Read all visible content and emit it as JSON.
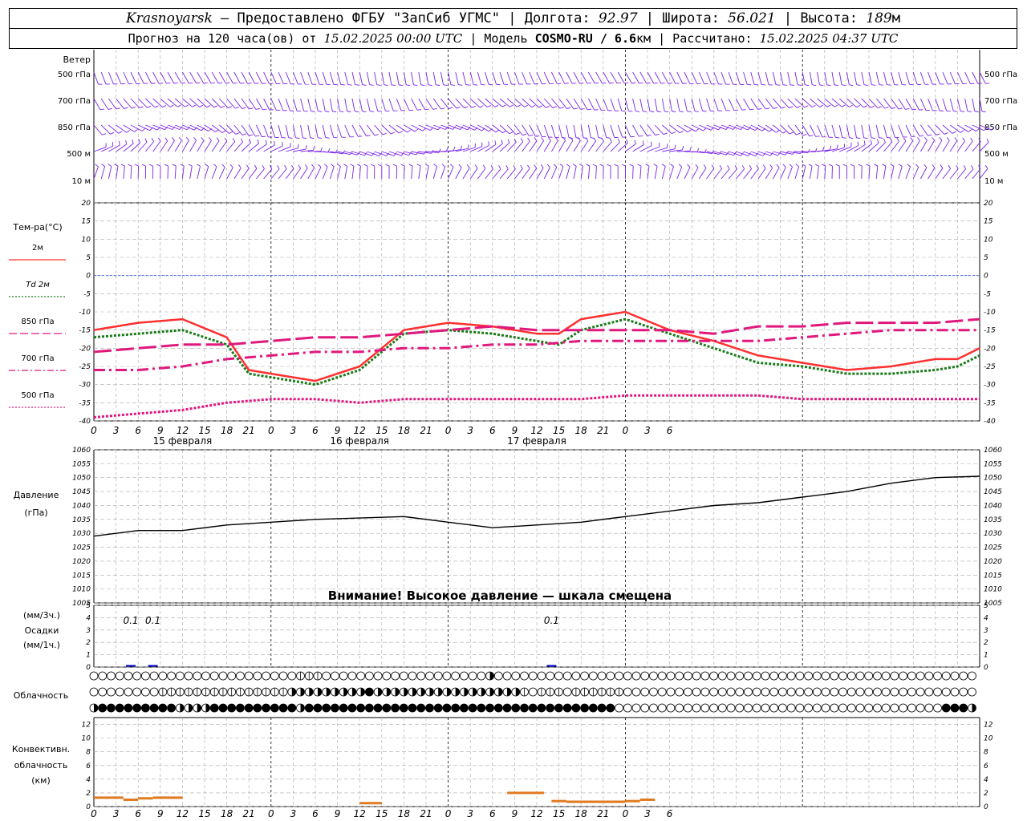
{
  "header": {
    "city": "Krasnoyarsk",
    "provider": "— Предоставлено ФГБУ \"ЗапСиб УГМС\"",
    "lon_label": "| Долгота:",
    "lon": "92.97",
    "lat_label": "| Широта:",
    "lat": "56.021",
    "alt_label": "| Высота:",
    "alt": "189",
    "alt_unit": "м",
    "forecast_label": "Прогноз на 120 часа(ов) от",
    "forecast_from": "15.02.2025 00:00 UTC",
    "model_label": "| Модель",
    "model": "COSMO-RU / 6.6",
    "model_unit": "км",
    "calc_label": "| Рассчитано:",
    "calc_time": "15.02.2025 04:37 UTC"
  },
  "wind_panel": {
    "title": "Ветер",
    "levels": [
      "500 гПа",
      "700 гПа",
      "850 гПа",
      "500 м",
      "10 м"
    ],
    "colors": {
      "barb": "#7a22e8"
    }
  },
  "chart_data": [
    {
      "type": "line",
      "panel": "temperature",
      "title": "Тем-ра(°C)",
      "x_ticks": [
        "0",
        "3",
        "6",
        "9",
        "12",
        "15",
        "18",
        "21",
        "0",
        "3",
        "6",
        "9",
        "12",
        "15",
        "18",
        "21",
        "0",
        "3",
        "6",
        "9",
        "12",
        "15",
        "18",
        "21",
        "0",
        "3",
        "6"
      ],
      "date_labels": [
        "15 февраля",
        "16 февраля",
        "17 февраля"
      ],
      "ylim": [
        -40,
        20
      ],
      "y_ticks": [
        20,
        15,
        10,
        5,
        0,
        -5,
        -10,
        -15,
        -20,
        -25,
        -30,
        -35,
        -40
      ],
      "series": [
        {
          "name": "2м",
          "color": "#ff3030",
          "style": "solid",
          "x": [
            0,
            6,
            12,
            18,
            21,
            24,
            30,
            36,
            42,
            48,
            54,
            57,
            60,
            63,
            66,
            72,
            78,
            84,
            90,
            96,
            102,
            108,
            114,
            117,
            120
          ],
          "y": [
            -15,
            -13,
            -12,
            -17,
            -26,
            -27,
            -29,
            -25,
            -15,
            -13,
            -14,
            -15,
            -16,
            -16,
            -12,
            -10,
            -15,
            -18,
            -22,
            -24,
            -26,
            -25,
            -23,
            -23,
            -20
          ]
        },
        {
          "name": "Td 2м",
          "color": "#1a7a1a",
          "style": "dotted",
          "x": [
            0,
            6,
            12,
            18,
            21,
            24,
            30,
            36,
            42,
            48,
            54,
            57,
            60,
            63,
            66,
            72,
            78,
            84,
            90,
            96,
            102,
            108,
            114,
            117,
            120
          ],
          "y": [
            -17,
            -16,
            -15,
            -19,
            -27,
            -28,
            -30,
            -26,
            -16,
            -15,
            -16,
            -17,
            -18,
            -19,
            -15,
            -12,
            -16,
            -20,
            -24,
            -25,
            -27,
            -27,
            -26,
            -25,
            -22
          ]
        },
        {
          "name": "850 гПа",
          "color": "#e0187e",
          "style": "longdash",
          "x": [
            0,
            6,
            12,
            18,
            24,
            30,
            36,
            42,
            48,
            54,
            60,
            66,
            72,
            78,
            84,
            90,
            96,
            102,
            108,
            114,
            120
          ],
          "y": [
            -21,
            -20,
            -19,
            -19,
            -18,
            -17,
            -17,
            -16,
            -15,
            -14,
            -15,
            -15,
            -15,
            -15,
            -16,
            -14,
            -14,
            -13,
            -13,
            -13,
            -12
          ]
        },
        {
          "name": "700 гПа",
          "color": "#e0187e",
          "style": "dashdot",
          "x": [
            0,
            6,
            12,
            18,
            24,
            30,
            36,
            42,
            48,
            54,
            60,
            66,
            72,
            78,
            84,
            90,
            96,
            102,
            108,
            114,
            120
          ],
          "y": [
            -26,
            -26,
            -25,
            -23,
            -22,
            -21,
            -21,
            -20,
            -20,
            -19,
            -19,
            -18,
            -18,
            -18,
            -18,
            -18,
            -17,
            -16,
            -15,
            -15,
            -15
          ]
        },
        {
          "name": "500 гПа",
          "color": "#e0187e",
          "style": "dotted",
          "x": [
            0,
            6,
            12,
            18,
            24,
            30,
            36,
            42,
            48,
            54,
            60,
            66,
            72,
            78,
            84,
            90,
            96,
            102,
            108,
            114,
            120
          ],
          "y": [
            -39,
            -38,
            -37,
            -35,
            -34,
            -34,
            -35,
            -34,
            -34,
            -34,
            -34,
            -34,
            -33,
            -33,
            -33,
            -33,
            -34,
            -34,
            -34,
            -34,
            -34
          ]
        },
        {
          "name": "0",
          "color": "#3355dd",
          "style": "zero",
          "x": [
            0,
            120
          ],
          "y": [
            0,
            0
          ]
        }
      ]
    },
    {
      "type": "line",
      "panel": "pressure",
      "title": "Давление",
      "unit": "(гПа)",
      "ylim": [
        1005,
        1060
      ],
      "y_ticks": [
        1060,
        1055,
        1050,
        1045,
        1040,
        1035,
        1030,
        1025,
        1020,
        1015,
        1010,
        1005
      ],
      "warning": "Внимание! Высокое давление — шкала смещена",
      "series": [
        {
          "name": "Давление",
          "color": "#000000",
          "x": [
            0,
            6,
            12,
            18,
            24,
            30,
            36,
            42,
            48,
            54,
            60,
            66,
            72,
            78,
            84,
            90,
            96,
            102,
            108,
            114,
            120
          ],
          "y": [
            1029,
            1031,
            1031,
            1033,
            1034,
            1035,
            1035.5,
            1036,
            1034,
            1032,
            1033,
            1034,
            1036,
            1038,
            1040,
            1041,
            1043,
            1045,
            1048,
            1050,
            1050.5
          ]
        }
      ]
    },
    {
      "type": "bar",
      "panel": "precipitation",
      "title": "Осадки",
      "units": [
        "(мм/3ч.)",
        "(мм/1ч.)"
      ],
      "ylim": [
        0,
        5
      ],
      "y_ticks": [
        5,
        4,
        3,
        2,
        1,
        0
      ],
      "labels": [
        {
          "x": 5,
          "text": "0.1"
        },
        {
          "x": 8,
          "text": "0.1"
        },
        {
          "x": 62,
          "text": "0.1"
        }
      ],
      "series": [
        {
          "name": "Осадки",
          "color": "#0000cc",
          "x": [
            5,
            8,
            62
          ],
          "values": [
            0.1,
            0.1,
            0.1
          ]
        }
      ]
    },
    {
      "type": "bar",
      "panel": "convective_cloud",
      "title": "Конвективн. облачность",
      "unit": "(км)",
      "ylim": [
        0,
        13
      ],
      "y_ticks": [
        12,
        10,
        8,
        6,
        4,
        2,
        0
      ],
      "series": [
        {
          "name": "Конвективная облачность",
          "color": "#e07a20",
          "segments": [
            [
              0,
              4,
              1.3
            ],
            [
              4,
              6,
              1.0
            ],
            [
              6,
              8,
              1.2
            ],
            [
              8,
              12,
              1.3
            ],
            [
              36,
              39,
              0.5
            ],
            [
              56,
              61,
              2.0
            ],
            [
              62,
              64,
              0.8
            ],
            [
              64,
              72,
              0.7
            ],
            [
              72,
              74,
              0.8
            ],
            [
              74,
              76,
              1.0
            ]
          ]
        }
      ]
    }
  ],
  "clouds": {
    "title": "Облачность",
    "rows": [
      "0000000000000000000000001110000000000000000000200000000000000000000000000000000000000000000000000000000",
      "0000000011111111111111122222222232222222222222222210111011111100000000000000000000000000000000000000000",
      "2333333333222233333333332333333333333333333333333333333333333000000000000000000000000000000000000003332"
    ]
  }
}
